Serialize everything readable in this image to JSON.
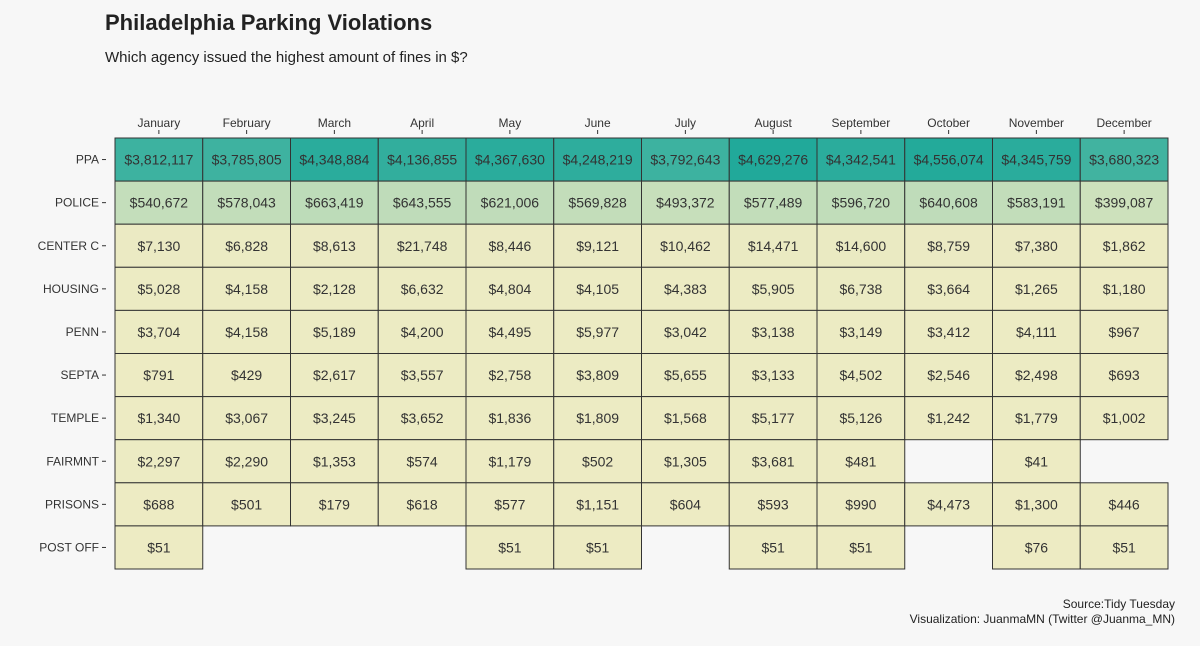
{
  "title": "Philadelphia Parking Violations",
  "subtitle": "Which agency issued the highest amount of fines in $?",
  "caption": {
    "source": "Source:Tidy Tuesday",
    "credit": "Visualization: JuanmaMN (Twitter @Juanma_MN)"
  },
  "chart_data": {
    "type": "heatmap",
    "columns": [
      "January",
      "February",
      "March",
      "April",
      "May",
      "June",
      "July",
      "August",
      "September",
      "October",
      "November",
      "December"
    ],
    "rows": [
      "PPA",
      "POLICE",
      "CENTER C",
      "HOUSING",
      "PENN",
      "SEPTA",
      "TEMPLE",
      "FAIRMNT",
      "PRISONS",
      "POST OFF"
    ],
    "values": [
      [
        3812117,
        3785805,
        4348884,
        4136855,
        4367630,
        4248219,
        3792643,
        4629276,
        4342541,
        4556074,
        4345759,
        3680323
      ],
      [
        540672,
        578043,
        663419,
        643555,
        621006,
        569828,
        493372,
        577489,
        596720,
        640608,
        583191,
        399087
      ],
      [
        7130,
        6828,
        8613,
        21748,
        8446,
        9121,
        10462,
        14471,
        14600,
        8759,
        7380,
        1862
      ],
      [
        5028,
        4158,
        2128,
        6632,
        4804,
        4105,
        4383,
        5905,
        6738,
        3664,
        1265,
        1180
      ],
      [
        3704,
        4158,
        5189,
        4200,
        4495,
        5977,
        3042,
        3138,
        3149,
        3412,
        4111,
        967
      ],
      [
        791,
        429,
        2617,
        3557,
        2758,
        3809,
        5655,
        3133,
        4502,
        2546,
        2498,
        693
      ],
      [
        1340,
        3067,
        3245,
        3652,
        1836,
        1809,
        1568,
        5177,
        5126,
        1242,
        1779,
        1002
      ],
      [
        2297,
        2290,
        1353,
        574,
        1179,
        502,
        1305,
        3681,
        481,
        null,
        41,
        null
      ],
      [
        688,
        501,
        179,
        618,
        577,
        1151,
        604,
        593,
        990,
        4473,
        1300,
        446
      ],
      [
        51,
        null,
        null,
        null,
        51,
        51,
        null,
        51,
        51,
        null,
        76,
        51
      ]
    ],
    "value_prefix": "$",
    "legend": "none",
    "colors": {
      "low": "#edebc3",
      "high": "#21a99a",
      "border": "#333333",
      "text": "#333333"
    }
  }
}
